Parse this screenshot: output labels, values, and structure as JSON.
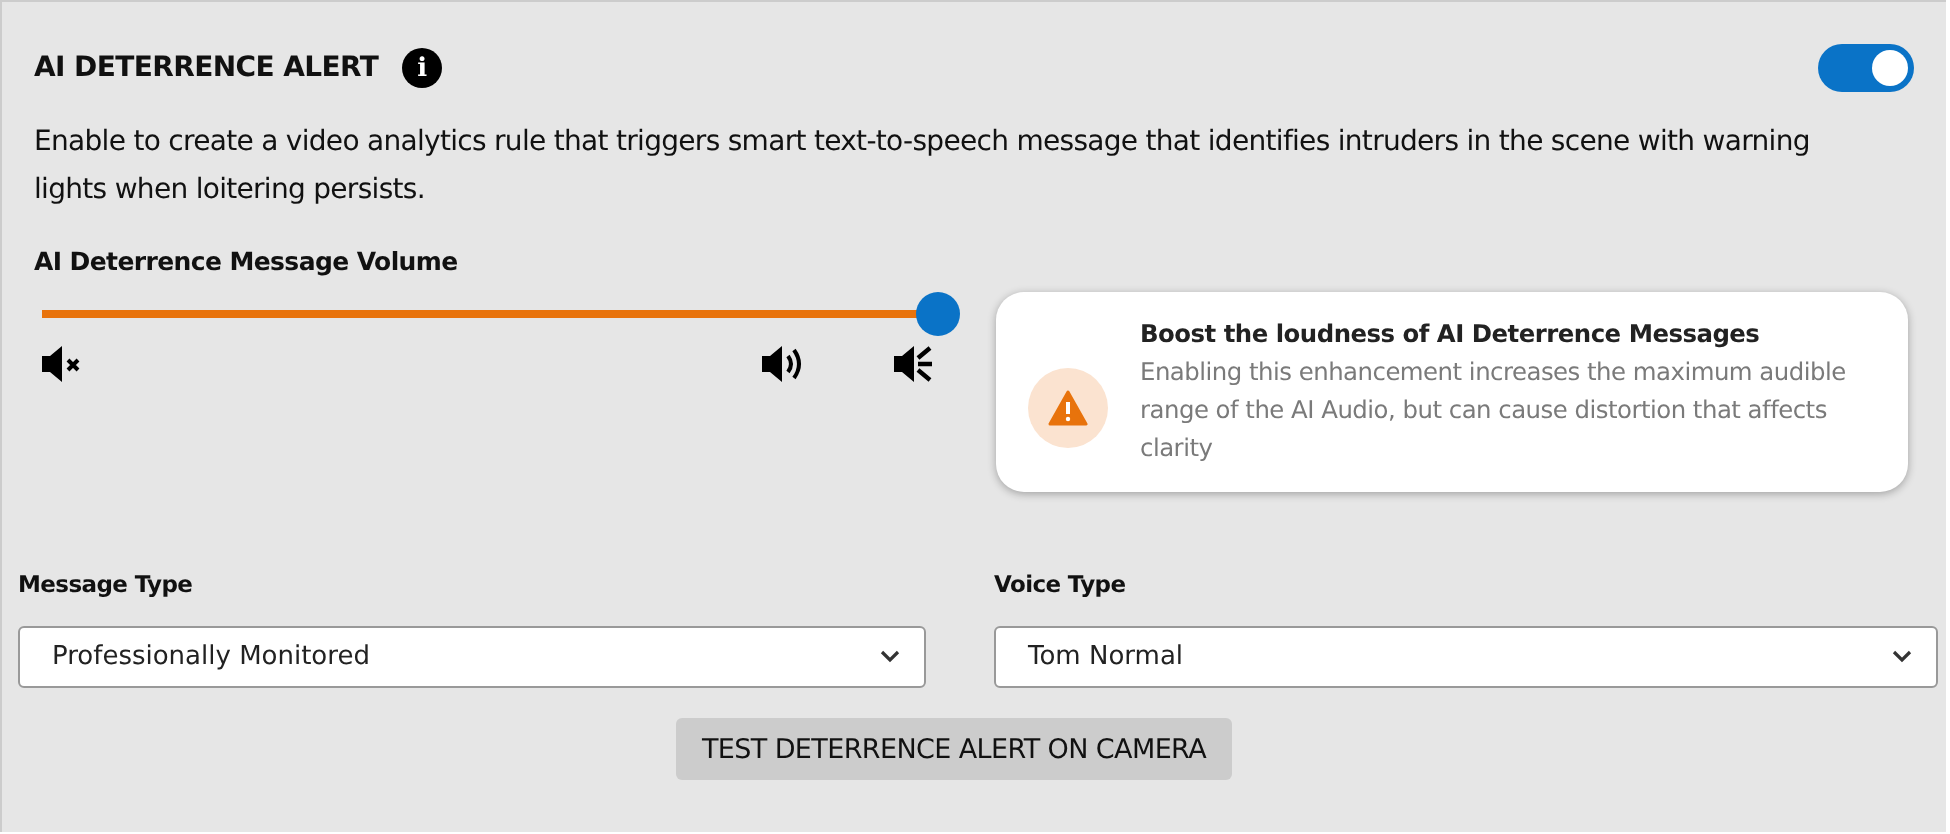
{
  "header": {
    "title": "AI DETERRENCE ALERT",
    "info_icon": "i",
    "enabled": true
  },
  "description": "Enable to create a video analytics rule that triggers smart text-to-speech message that identifies intruders in the scene with warning lights when loitering persists.",
  "volume": {
    "label": "AI Deterrence Message Volume",
    "level": 1
  },
  "boost_tip": {
    "title": "Boost the loudness of AI Deterrence Messages",
    "text": "Enabling this enhancement increases the maximum audible range of the AI Audio, but can cause distortion that affects clarity"
  },
  "dropdowns": [
    {
      "label": "Message Type",
      "value": "Professionally Monitored"
    },
    {
      "label": "Voice Type",
      "value": "Tom Normal"
    }
  ],
  "test_button": "TEST DETERRENCE ALERT ON CAMERA"
}
